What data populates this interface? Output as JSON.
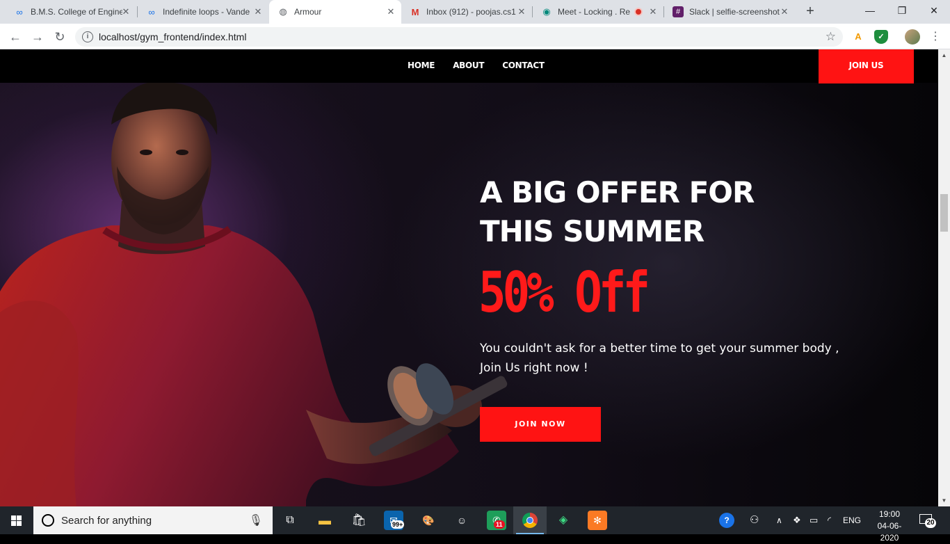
{
  "browser": {
    "tabs": [
      {
        "title": "B.M.S. College of Engine",
        "icon": "infinity-icon"
      },
      {
        "title": "Indefinite loops - Vande",
        "icon": "infinity-icon"
      },
      {
        "title": "Armour",
        "icon": "globe-icon"
      },
      {
        "title": "Inbox (912) - poojas.cs1",
        "icon": "gmail-icon"
      },
      {
        "title": "Meet - Locking . Re",
        "icon": "meet-icon"
      },
      {
        "title": "Slack | selfie-screenshot",
        "icon": "slack-icon"
      }
    ],
    "active_tab_index": 2,
    "url": "localhost/gym_frontend/index.html"
  },
  "site": {
    "nav": [
      "HOME",
      "ABOUT",
      "CONTACT"
    ],
    "join_us": "JOIN US",
    "headline_line1": "A BIG OFFER FOR",
    "headline_line2": "THIS SUMMER",
    "offer": "50% Off",
    "subtext": "You couldn't ask for a better time to get your summer body , Join Us right now !",
    "cta": "JOIN NOW",
    "accent_color": "#ff1313"
  },
  "taskbar": {
    "search_placeholder": "Search for anything",
    "mail_badge": "99+",
    "whatsapp_badge": "11",
    "language": "ENG",
    "time": "19:00",
    "date": "04-06-2020",
    "notifications": "20"
  }
}
